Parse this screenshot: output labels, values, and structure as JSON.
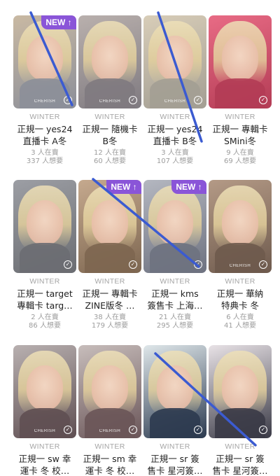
{
  "accent_color": "#8a55d8",
  "stroke_color": "#3b5bd1",
  "new_badge_label": "NEW ↑",
  "cherish_label": "CHERISH",
  "check_glyph": "✓",
  "cards": [
    {
      "artist": "WINTER",
      "title": "正規一 yes24\n直播卡 A冬",
      "selling": "3 人在賣",
      "wanting": "337 人想要",
      "is_new": true,
      "cherish": true,
      "palette": [
        "#c9b9a3",
        "#8c8f99"
      ]
    },
    {
      "artist": "WINTER",
      "title": "正規一 隨機卡\nB冬",
      "selling": "12 人在賣",
      "wanting": "60 人想要",
      "is_new": false,
      "cherish": true,
      "palette": [
        "#b9b0ad",
        "#7f7a80"
      ]
    },
    {
      "artist": "WINTER",
      "title": "正規一 yes24\n直播卡 B冬",
      "selling": "3 人在賣",
      "wanting": "107 人想要",
      "is_new": false,
      "cherish": true,
      "palette": [
        "#d8cdb8",
        "#a39e93"
      ]
    },
    {
      "artist": "WINTER",
      "title": "正規一 專輯卡\nSMini冬",
      "selling": "9 人在賣",
      "wanting": "69 人想要",
      "is_new": false,
      "cherish": false,
      "palette": [
        "#e86b85",
        "#b33c55"
      ]
    },
    {
      "artist": "WINTER",
      "title": "正規一 target\n專輯卡 targ…",
      "selling": "2 人在賣",
      "wanting": "86 人想要",
      "is_new": false,
      "cherish": false,
      "palette": [
        "#9c9ea4",
        "#6b6d72"
      ]
    },
    {
      "artist": "WINTER",
      "title": "正規一 專輯卡\nZINE版冬 …",
      "selling": "38 人在賣",
      "wanting": "179 人想要",
      "is_new": true,
      "cherish": false,
      "palette": [
        "#c5a98e",
        "#7d6650"
      ]
    },
    {
      "artist": "WINTER",
      "title": "正規一 kms\n簽售卡 上海…",
      "selling": "21 人在賣",
      "wanting": "295 人想要",
      "is_new": true,
      "cherish": false,
      "palette": [
        "#b4b7c0",
        "#6e7280"
      ]
    },
    {
      "artist": "WINTER",
      "title": "正規一 華納\n特典卡 冬",
      "selling": "6 人在賣",
      "wanting": "41 人想要",
      "is_new": false,
      "cherish": true,
      "palette": [
        "#b49a86",
        "#6e5a4d"
      ]
    },
    {
      "artist": "WINTER",
      "title": "正規一 sw 幸\n運卡 冬 校…",
      "selling": "",
      "wanting": "",
      "is_new": false,
      "cherish": true,
      "palette": [
        "#b8b0b0",
        "#5f4f52"
      ]
    },
    {
      "artist": "WINTER",
      "title": "正規一 sm 幸\n運卡 冬 校…",
      "selling": "",
      "wanting": "",
      "is_new": false,
      "cherish": true,
      "palette": [
        "#c7bdbb",
        "#6a5558"
      ]
    },
    {
      "artist": "WINTER",
      "title": "正規一 sr 簽\n售卡 星河簽…",
      "selling": "",
      "wanting": "",
      "is_new": false,
      "cherish": false,
      "palette": [
        "#dfe7ea",
        "#2c3a4f"
      ]
    },
    {
      "artist": "WINTER",
      "title": "正規一 sr 簽\n售卡 星河簽…",
      "selling": "",
      "wanting": "",
      "is_new": false,
      "cherish": false,
      "palette": [
        "#e8e2e6",
        "#3a3a46"
      ]
    }
  ]
}
